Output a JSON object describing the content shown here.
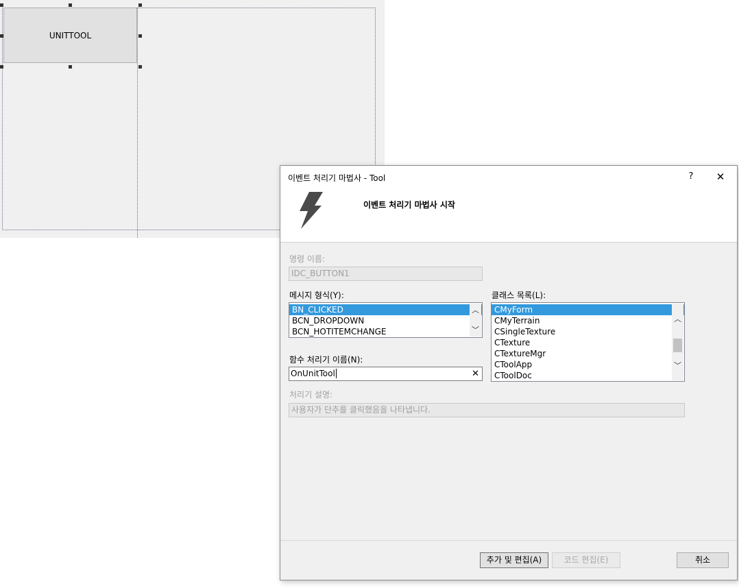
{
  "designer": {
    "button_label": "UNITTOOL"
  },
  "dialog": {
    "title": "이벤트 처리기 마법사 - Tool",
    "help_glyph": "?",
    "close_glyph": "✕",
    "header": "이벤트 처리기 마법사 시작",
    "command_name": {
      "label": "명령 이름:",
      "value": "IDC_BUTTON1"
    },
    "message_type": {
      "label": "메시지 형식(Y):",
      "items": [
        "BN_CLICKED",
        "BCN_DROPDOWN",
        "BCN_HOTITEMCHANGE"
      ],
      "selected_index": 0
    },
    "class_list": {
      "label": "클래스 목록(L):",
      "items": [
        "CMyForm",
        "CMyTerrain",
        "CSingleTexture",
        "CTexture",
        "CTextureMgr",
        "CToolApp",
        "CToolDoc"
      ],
      "selected_index": 0
    },
    "handler_name": {
      "label": "함수 처리기 이름(N):",
      "value": "OnUnitTool",
      "clear_glyph": "✕"
    },
    "handler_description": {
      "label": "처리기 설명:",
      "value": "사용자가 단추를 클릭했음을 나타냅니다."
    },
    "buttons": {
      "add_edit": "추가 및 편집(A)",
      "code_edit": "코드 편집(E)",
      "cancel": "취소"
    }
  },
  "colors": {
    "selection": "#3399dd",
    "dialog_bg": "#f0f0f0"
  }
}
